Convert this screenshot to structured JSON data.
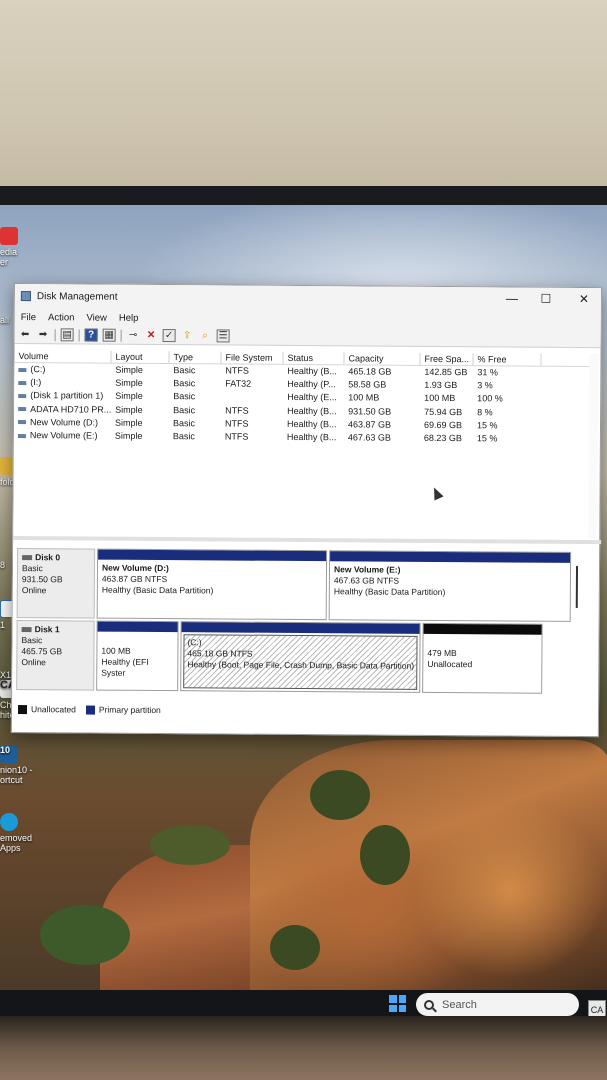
{
  "window": {
    "title": "Disk Management",
    "controls": {
      "minimize": "—",
      "maximize": "☐",
      "close": "✕"
    }
  },
  "menu": [
    "File",
    "Action",
    "View",
    "Help"
  ],
  "toolbar_icons": [
    "back-arrow-icon",
    "forward-arrow-icon",
    "view-icon",
    "help-icon",
    "properties-icon",
    "connect-icon",
    "delete-icon",
    "check-icon",
    "import-icon",
    "search-icon",
    "list-icon"
  ],
  "volume_list": {
    "columns": [
      "Volume",
      "Layout",
      "Type",
      "File System",
      "Status",
      "Capacity",
      "Free Spa...",
      "% Free"
    ],
    "rows": [
      [
        "(C:)",
        "Simple",
        "Basic",
        "NTFS",
        "Healthy (B...",
        "465.18 GB",
        "142.85 GB",
        "31 %"
      ],
      [
        "(I:)",
        "Simple",
        "Basic",
        "FAT32",
        "Healthy (P...",
        "58.58 GB",
        "1.93 GB",
        "3 %"
      ],
      [
        "(Disk 1 partition 1)",
        "Simple",
        "Basic",
        "",
        "Healthy (E...",
        "100 MB",
        "100 MB",
        "100 %"
      ],
      [
        "ADATA HD710 PR...",
        "Simple",
        "Basic",
        "NTFS",
        "Healthy (B...",
        "931.50 GB",
        "75.94 GB",
        "8 %"
      ],
      [
        "New Volume (D:)",
        "Simple",
        "Basic",
        "NTFS",
        "Healthy (B...",
        "463.87 GB",
        "69.69 GB",
        "15 %"
      ],
      [
        "New Volume (E:)",
        "Simple",
        "Basic",
        "NTFS",
        "Healthy (B...",
        "467.63 GB",
        "68.23 GB",
        "15 %"
      ]
    ]
  },
  "disks": [
    {
      "name": "Disk 0",
      "type": "Basic",
      "size": "931.50 GB",
      "state": "Online",
      "partitions": [
        {
          "name": "New Volume  (D:)",
          "size_fs": "463.87 GB NTFS",
          "status": "Healthy (Basic Data Partition)"
        },
        {
          "name": "New Volume  (E:)",
          "size_fs": "467.63 GB NTFS",
          "status": "Healthy (Basic Data Partition)"
        }
      ]
    },
    {
      "name": "Disk 1",
      "type": "Basic",
      "size": "465.75 GB",
      "state": "Online",
      "partitions": [
        {
          "name": "",
          "size_fs": "100 MB",
          "status": "Healthy (EFI Syster"
        },
        {
          "name": "(C:)",
          "size_fs": "465.18 GB NTFS",
          "status": "Healthy (Boot, Page File, Crash Dump, Basic Data Partition)"
        },
        {
          "name": "",
          "size_fs": "479 MB",
          "status": "Unallocated"
        }
      ]
    }
  ],
  "legend": [
    {
      "label": "Unallocated",
      "color": "#111111"
    },
    {
      "label": "Primary partition",
      "color": "#1a2c7c"
    }
  ],
  "desktop_icons": [
    "edia",
    "er",
    "all",
    "fold",
    "8",
    "1",
    "X14",
    "Chief",
    "hitect",
    "10",
    "nion10 -",
    "ortcut",
    "emoved",
    "Apps"
  ],
  "taskbar": {
    "search_placeholder": "Search",
    "tray_label": "CA"
  }
}
